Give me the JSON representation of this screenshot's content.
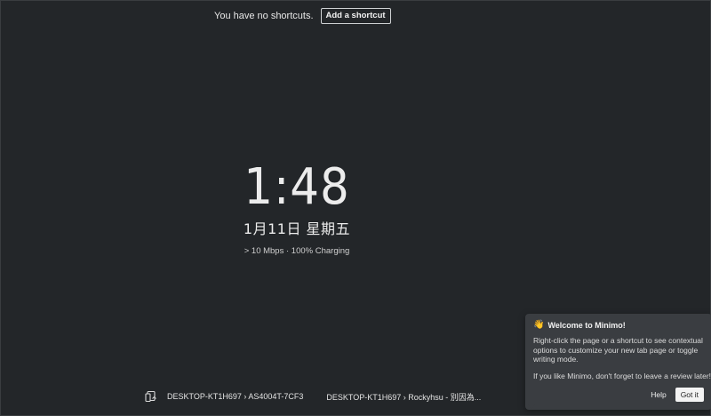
{
  "shortcuts": {
    "empty_text": "You have no shortcuts.",
    "add_label": "Add a shortcut"
  },
  "clock": {
    "time": "1:48",
    "date": "1月11日 星期五",
    "status": "> 10 Mbps · 100% Charging"
  },
  "devices": {
    "icon": "sync-devices-icon",
    "items": [
      {
        "label": "DESKTOP-KT1H697 › AS4004T-7CF3"
      },
      {
        "label": "DESKTOP-KT1H697 › Rockyhsu - 別因為..."
      }
    ]
  },
  "welcome": {
    "icon": "waving-hand-icon",
    "title": "Welcome to Minimo!",
    "body": "Right-click the page or a shortcut to see contextual options to customize your new tab page or toggle writing mode.",
    "review": "If you like Minimo, don't forget to leave a review later!",
    "help_label": "Help",
    "gotit_label": "Got it"
  },
  "colors": {
    "background": "#232629",
    "popup": "#3a3d41",
    "text": "#e6e6e6"
  }
}
